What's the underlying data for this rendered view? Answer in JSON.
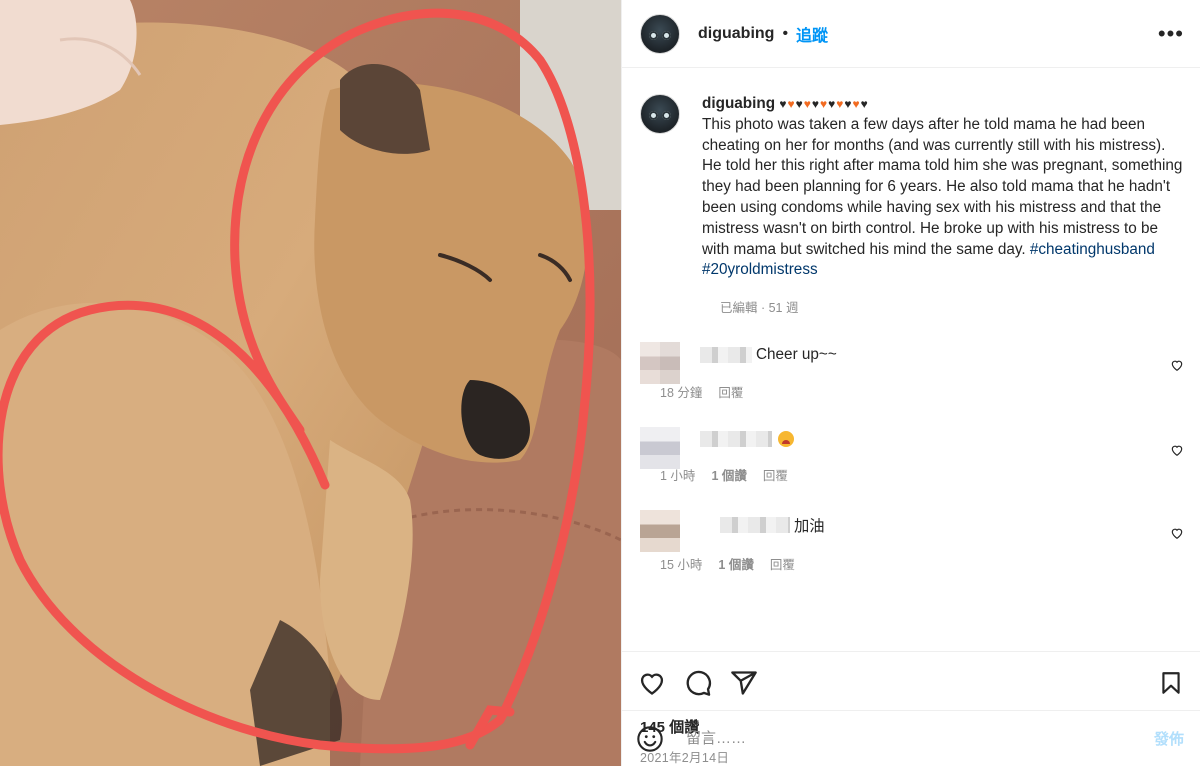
{
  "post": {
    "username": "diguabing",
    "follow_label": "追蹤",
    "separator": "•",
    "more_label": "•••"
  },
  "caption": {
    "username": "diguabing",
    "hearts": [
      "♥",
      "♥",
      "♥",
      "♥",
      "♥",
      "♥",
      "♥",
      "♥",
      "♥",
      "♥",
      "♥",
      "♥"
    ],
    "text": "This photo was taken a few days after he told mama he had been cheating on her for months (and was currently still with his mistress). He told her this right after mama told him she was pregnant, something they had been planning for 6 years. He also told mama that he hadn't been using condoms while having sex with his mistress and that the mistress wasn't on birth control. He broke up with his mistress to be with mama but switched his mind the same day.",
    "hashtags": [
      "#cheatinghusband",
      "#20yroldmistress"
    ],
    "meta": "已編輯 · 51 週"
  },
  "comments": [
    {
      "text": "Cheer up~~",
      "time": "18 分鐘",
      "likes": "",
      "reply": "回覆"
    },
    {
      "text": "",
      "emoji": "worried-face-emoji",
      "time": "1 小時",
      "likes": "1 個讚",
      "reply": "回覆"
    },
    {
      "text": "加油",
      "time": "15 小時",
      "likes": "1 個讚",
      "reply": "回覆"
    }
  ],
  "stats": {
    "likes": "145 個讚",
    "date": "2021年2月14日"
  },
  "composer": {
    "placeholder": "留言……",
    "post_label": "發佈"
  },
  "icons": {
    "like": "heart-icon",
    "comment": "comment-icon",
    "share": "paper-plane-icon",
    "save": "bookmark-icon",
    "emoji": "smiley-icon"
  },
  "colors": {
    "accent": "#0095f6",
    "hashtag": "#00376b",
    "heart_orange": "#f26b21",
    "annotation": "#f0544f"
  }
}
